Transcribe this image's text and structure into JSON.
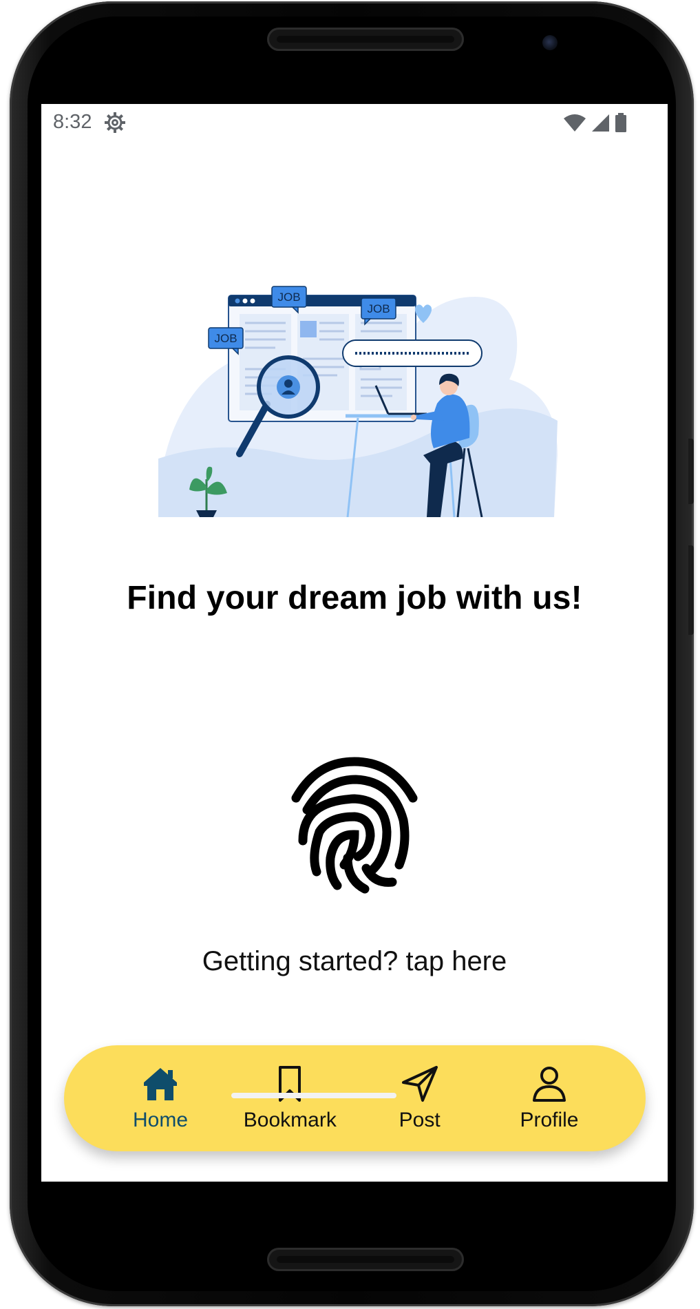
{
  "status_bar": {
    "time": "8:32",
    "icons": [
      "settings-gear-icon",
      "wifi-icon",
      "cellular-signal-icon",
      "battery-icon"
    ]
  },
  "hero": {
    "illustration": "job-search-illustration",
    "job_tags": [
      "JOB",
      "JOB",
      "JOB"
    ]
  },
  "main": {
    "headline": "Find your dream job with us!",
    "fingerprint_icon": "fingerprint-icon",
    "cta_text": "Getting started? tap here"
  },
  "bottom_nav": {
    "background_color": "#fcdd5b",
    "active_color": "#0f4d6b",
    "items": [
      {
        "label": "Home",
        "icon": "home-icon",
        "active": true
      },
      {
        "label": "Bookmark",
        "icon": "bookmark-icon",
        "active": false
      },
      {
        "label": "Post",
        "icon": "send-icon",
        "active": false
      },
      {
        "label": "Profile",
        "icon": "person-icon",
        "active": false
      }
    ]
  }
}
